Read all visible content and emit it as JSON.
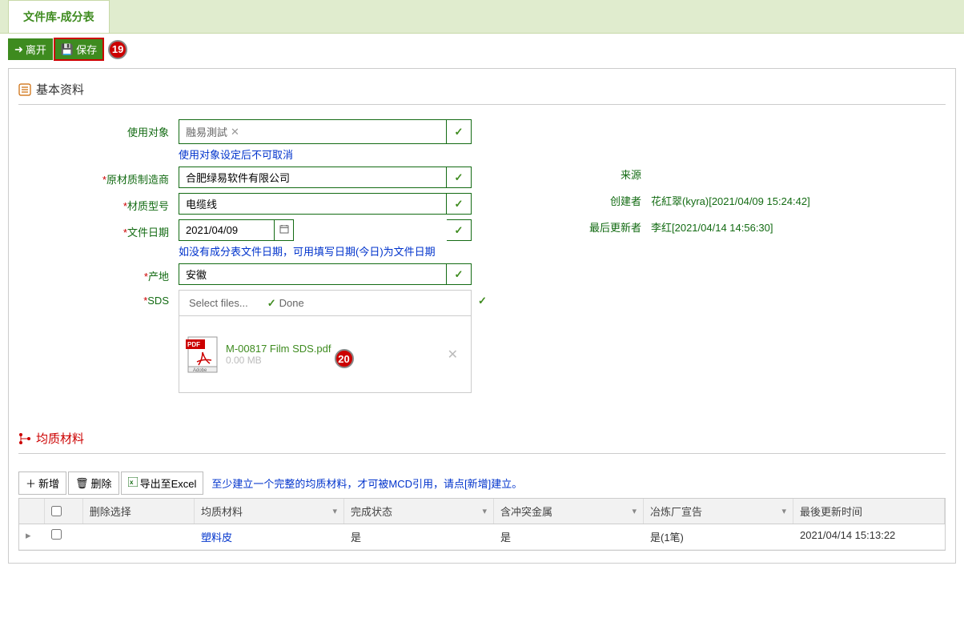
{
  "tab_title": "文件库-成分表",
  "toolbar": {
    "leave": "离开",
    "save": "保存"
  },
  "badges": {
    "save_step": "19",
    "file_step": "20"
  },
  "basic": {
    "title": "基本资料",
    "labels": {
      "target": "使用对象",
      "manufacturer": "原材质制造商",
      "model": "材质型号",
      "file_date": "文件日期",
      "origin": "产地",
      "sds": "SDS",
      "source": "来源",
      "creator": "创建者",
      "updater": "最后更新者"
    },
    "values": {
      "target_tag": "融易測試",
      "manufacturer": "合肥绿易软件有限公司",
      "model": "电缆线",
      "file_date": "2021/04/09",
      "origin": "安徽",
      "creator": "花紅翠(kyra)[2021/04/09 15:24:42]",
      "updater": "李红[2021/04/14 14:56:30]"
    },
    "hints": {
      "target": "使用对象设定后不可取消",
      "file_date": "如没有成分表文件日期，可用填写日期(今日)为文件日期"
    },
    "file": {
      "select_label": "Select files...",
      "done_label": "Done",
      "file_name": "M-00817 Film  SDS.pdf",
      "file_size": "0.00 MB"
    }
  },
  "materials": {
    "title": "均质材料",
    "toolbar": {
      "add": "新增",
      "delete": "删除",
      "export": "导出至Excel"
    },
    "hint": "至少建立一个完整的均质材料，才可被MCD引用，请点[新增]建立。",
    "headers": {
      "del_sel": "删除选择",
      "material": "均质材料",
      "status": "完成状态",
      "conflict": "含冲突金属",
      "plant": "冶炼厂宣告",
      "update_time": "最後更新时间"
    },
    "rows": [
      {
        "material": "塑料皮",
        "status": "是",
        "conflict": "是",
        "plant": "是(1笔)",
        "update_time": "2021/04/14 15:13:22"
      }
    ]
  }
}
